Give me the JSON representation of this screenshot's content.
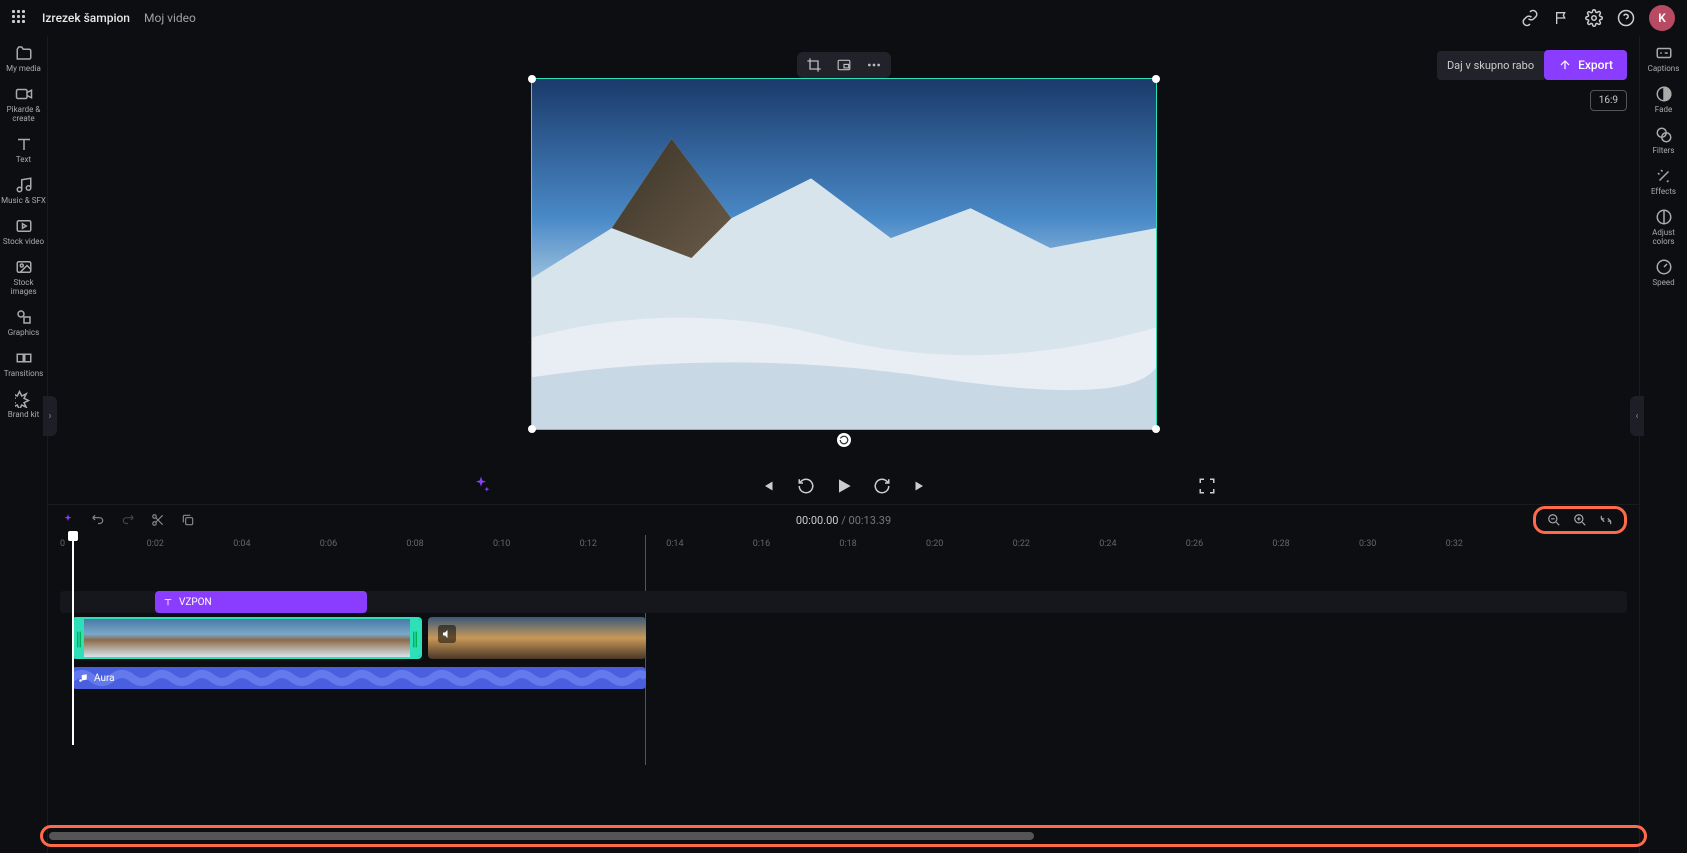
{
  "header": {
    "brand": "Izrezek šampion",
    "project": "Moj video",
    "avatar_initial": "K"
  },
  "share_export": {
    "share_label": "Daj v skupno rabo",
    "export_label": "Export"
  },
  "aspect_ratio": "16:9",
  "left_sidebar": {
    "my_media": "My media",
    "record_create": "Pikarde & create",
    "text": "Text",
    "music_sfx": "Music & SFX",
    "stock_video": "Stock video",
    "stock_images": "Stock images",
    "graphics": "Graphics",
    "transitions": "Transitions",
    "brand_kit": "Brand kit"
  },
  "right_sidebar": {
    "captions": "Captions",
    "fade": "Fade",
    "filters": "Filters",
    "effects": "Effects",
    "adjust_colors": "Adjust colors",
    "speed": "Speed"
  },
  "time": {
    "current": "00:00.00",
    "total": "00:13.39"
  },
  "ruler_ticks": [
    "0",
    "0:02",
    "0:04",
    "0:06",
    "0:08",
    "0:10",
    "0:12",
    "0:14",
    "0:16",
    "0:18",
    "0:20",
    "0:22",
    "0:24",
    "0:26",
    "0:28",
    "0:30",
    "0:32"
  ],
  "clips": {
    "text_label": "VZPON",
    "audio_label": "Aura"
  }
}
